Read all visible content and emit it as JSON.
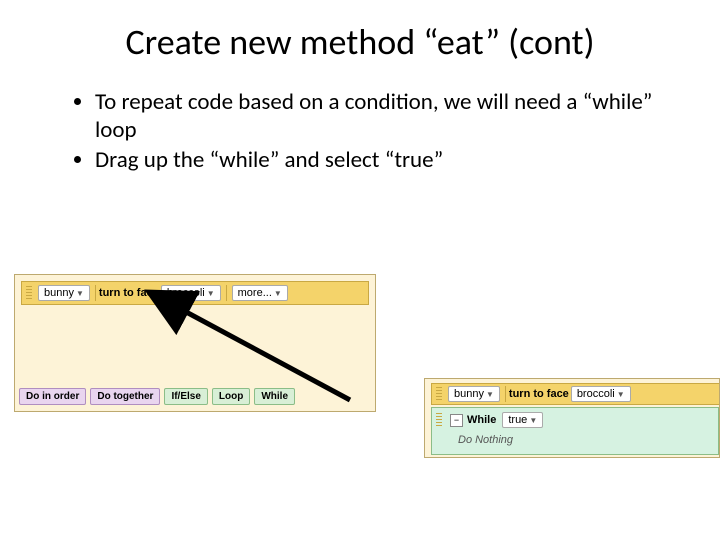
{
  "slide": {
    "title": "Create new method “eat” (cont)",
    "bullets": [
      "To repeat code based on a condition, we will need a “while” loop",
      "Drag up the “while” and select “true”"
    ]
  },
  "panel1": {
    "statement": {
      "object": "bunny",
      "action": "turn to face",
      "target": "broccoli",
      "more": "more..."
    },
    "tiles": [
      "Do in order",
      "Do together",
      "If/Else",
      "Loop",
      "While"
    ]
  },
  "panel2": {
    "statement": {
      "object": "bunny",
      "action": "turn to face",
      "target": "broccoli"
    },
    "while": {
      "keyword": "While",
      "condition": "true",
      "body": "Do Nothing"
    }
  }
}
